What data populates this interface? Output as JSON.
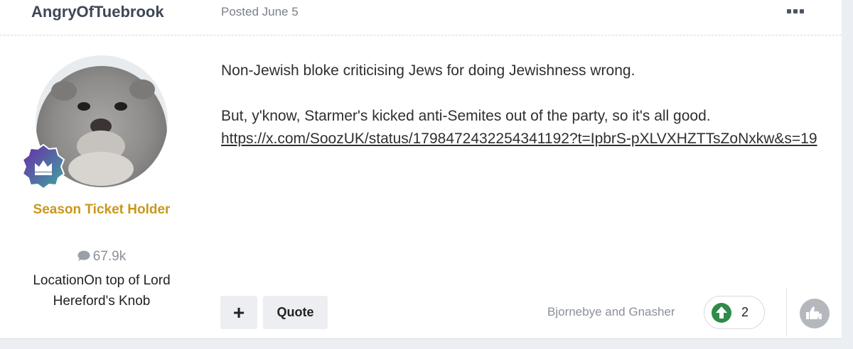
{
  "header": {
    "author": "AngryOfTuebrook",
    "posted": "Posted June 5",
    "menu_icon": "more-horizontal-icon"
  },
  "profile": {
    "rank": "Season Ticket Holder",
    "post_count": "67.9k",
    "location": "LocationOn top of Lord Hereford's Knob",
    "colors": {
      "rank": "#c9971b",
      "badge_start": "#6a2aa8",
      "badge_end": "#3fa7a0"
    }
  },
  "post": {
    "line1": "Non-Jewish bloke criticising Jews for doing Jewishness wrong.",
    "line2": "But, y'know, Starmer's kicked anti-Semites out of the party, so it's all good.",
    "link": "https://x.com/SoozUK/status/1798472432254341192?t=IpbrS-pXLVXHZTTsZoNxkw&s=19"
  },
  "actions": {
    "plus_label": "+",
    "quote_label": "Quote",
    "likers": "Bjornebye and Gnasher",
    "reaction_count": "2",
    "reaction_color": "#2e8b4a"
  }
}
